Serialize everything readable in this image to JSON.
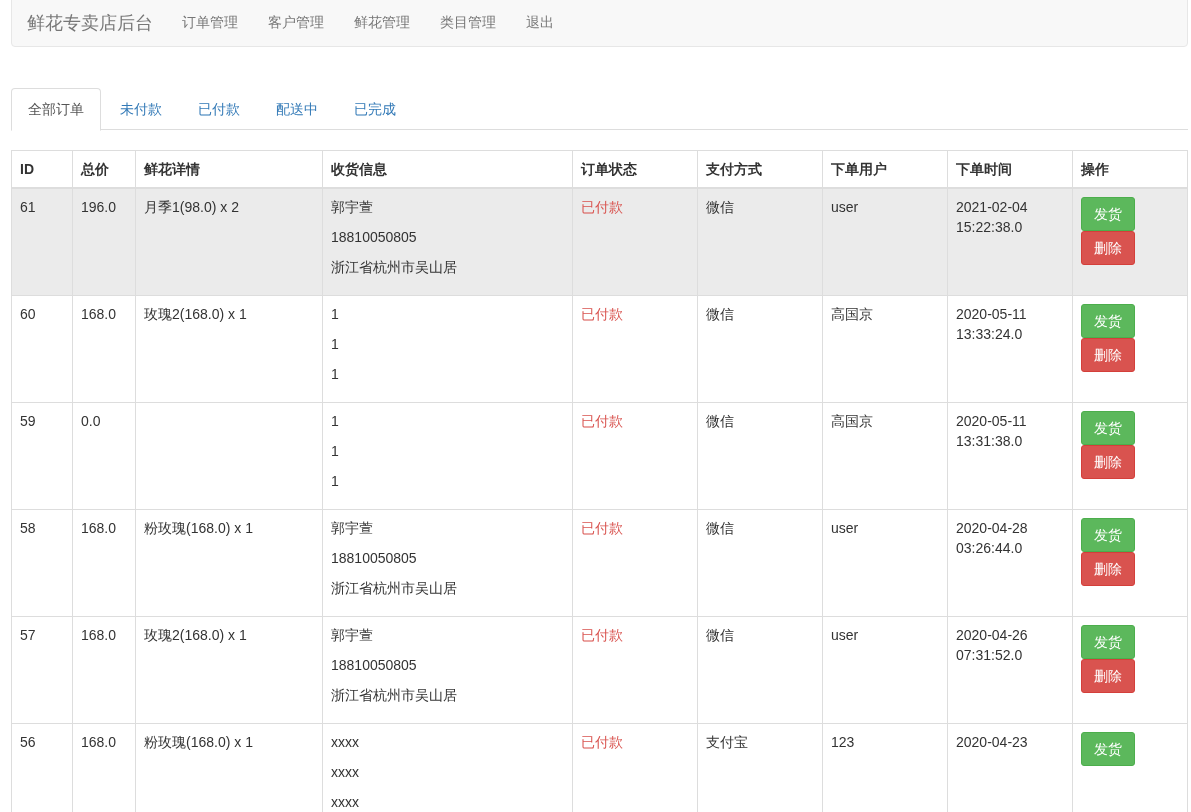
{
  "navbar": {
    "brand": "鲜花专卖店后台",
    "links": [
      "订单管理",
      "客户管理",
      "鲜花管理",
      "类目管理",
      "退出"
    ]
  },
  "tabs": [
    {
      "label": "全部订单",
      "selected": true
    },
    {
      "label": "未付款",
      "selected": false
    },
    {
      "label": "已付款",
      "selected": false
    },
    {
      "label": "配送中",
      "selected": false
    },
    {
      "label": "已完成",
      "selected": false
    }
  ],
  "table": {
    "columns": [
      "ID",
      "总价",
      "鲜花详情",
      "收货信息",
      "订单状态",
      "支付方式",
      "下单用户",
      "下单时间",
      "操作"
    ],
    "rows": [
      {
        "selected": true,
        "id": "61",
        "total": "196.0",
        "flowers": "月季1(98.0) x 2",
        "shipping": [
          "郭宇萱",
          "18810050805",
          "浙江省杭州市吴山居"
        ],
        "status": "已付款",
        "payment": "微信",
        "user": "user",
        "time": [
          "2021-02-04",
          "15:22:38.0"
        ],
        "actions": [
          {
            "label": "发货",
            "kind": "ship"
          },
          {
            "label": "删除",
            "kind": "delete"
          }
        ]
      },
      {
        "selected": false,
        "id": "60",
        "total": "168.0",
        "flowers": "玫瑰2(168.0) x 1",
        "shipping": [
          "1",
          "1",
          "1"
        ],
        "status": "已付款",
        "payment": "微信",
        "user": "高国京",
        "time": [
          "2020-05-11",
          "13:33:24.0"
        ],
        "actions": [
          {
            "label": "发货",
            "kind": "ship"
          },
          {
            "label": "删除",
            "kind": "delete"
          }
        ]
      },
      {
        "selected": false,
        "id": "59",
        "total": "0.0",
        "flowers": "",
        "shipping": [
          "1",
          "1",
          "1"
        ],
        "status": "已付款",
        "payment": "微信",
        "user": "高国京",
        "time": [
          "2020-05-11",
          "13:31:38.0"
        ],
        "actions": [
          {
            "label": "发货",
            "kind": "ship"
          },
          {
            "label": "删除",
            "kind": "delete"
          }
        ]
      },
      {
        "selected": false,
        "id": "58",
        "total": "168.0",
        "flowers": "粉玫瑰(168.0) x 1",
        "shipping": [
          "郭宇萱",
          "18810050805",
          "浙江省杭州市吴山居"
        ],
        "status": "已付款",
        "payment": "微信",
        "user": "user",
        "time": [
          "2020-04-28",
          "03:26:44.0"
        ],
        "actions": [
          {
            "label": "发货",
            "kind": "ship"
          },
          {
            "label": "删除",
            "kind": "delete"
          }
        ]
      },
      {
        "selected": false,
        "id": "57",
        "total": "168.0",
        "flowers": "玫瑰2(168.0) x 1",
        "shipping": [
          "郭宇萱",
          "18810050805",
          "浙江省杭州市吴山居"
        ],
        "status": "已付款",
        "payment": "微信",
        "user": "user",
        "time": [
          "2020-04-26",
          "07:31:52.0"
        ],
        "actions": [
          {
            "label": "发货",
            "kind": "ship"
          },
          {
            "label": "删除",
            "kind": "delete"
          }
        ]
      },
      {
        "selected": false,
        "id": "56",
        "total": "168.0",
        "flowers": "粉玫瑰(168.0) x 1",
        "shipping": [
          "xxxx",
          "xxxx",
          "xxxx"
        ],
        "status": "已付款",
        "payment": "支付宝",
        "user": "123",
        "time": [
          "2020-04-23"
        ],
        "actions": [
          {
            "label": "发货",
            "kind": "ship"
          }
        ]
      }
    ]
  }
}
